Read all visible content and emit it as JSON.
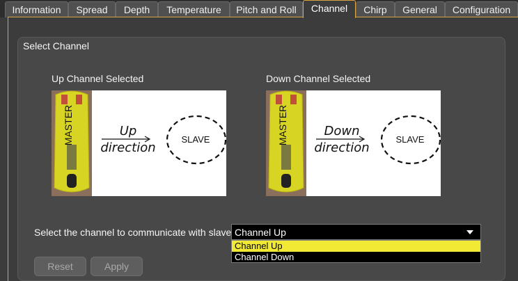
{
  "tabs": [
    {
      "label": "Information",
      "active": false
    },
    {
      "label": "Spread",
      "active": false
    },
    {
      "label": "Depth",
      "active": false
    },
    {
      "label": "Temperature",
      "active": false
    },
    {
      "label": "Pitch and Roll",
      "active": false
    },
    {
      "label": "Channel",
      "active": true
    },
    {
      "label": "Chirp",
      "active": false
    },
    {
      "label": "General",
      "active": false
    },
    {
      "label": "Configuration",
      "active": false
    }
  ],
  "group": {
    "title": "Select Channel"
  },
  "up_panel": {
    "caption": "Up Channel Selected",
    "master_label": "MASTER",
    "arrow_top": "Up",
    "arrow_bottom": "direction",
    "slave_label": "SLAVE"
  },
  "down_panel": {
    "caption": "Down Channel Selected",
    "master_label": "MASTER",
    "arrow_top": "Down",
    "arrow_bottom": "direction",
    "slave_label": "SLAVE"
  },
  "selector": {
    "label": "Select the channel to communicate with slave",
    "value": "Channel Up",
    "options": [
      {
        "label": "Channel Up",
        "highlighted": true
      },
      {
        "label": "Channel Down",
        "highlighted": false
      }
    ]
  },
  "buttons": {
    "reset": "Reset",
    "apply": "Apply"
  },
  "colors": {
    "accent": "#d9a441",
    "highlight": "#f2e935",
    "device_yellow": "#d8d424"
  }
}
